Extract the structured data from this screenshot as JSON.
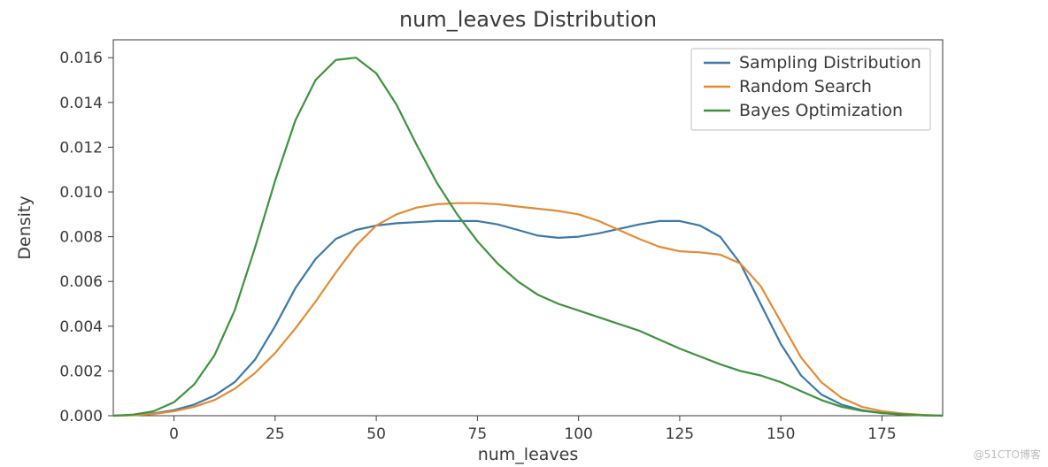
{
  "chart_data": {
    "type": "line",
    "title": "num_leaves Distribution",
    "xlabel": "num_leaves",
    "ylabel": "Density",
    "xlim": [
      -15,
      190
    ],
    "ylim": [
      0,
      0.0168
    ],
    "xticks": [
      0,
      25,
      50,
      75,
      100,
      125,
      150,
      175
    ],
    "yticks": [
      0.0,
      0.002,
      0.004,
      0.006,
      0.008,
      0.01,
      0.012,
      0.014,
      0.016
    ],
    "ytick_labels": [
      "0.000",
      "0.002",
      "0.004",
      "0.006",
      "0.008",
      "0.010",
      "0.012",
      "0.014",
      "0.016"
    ],
    "legend": {
      "position": "upper right",
      "entries": [
        "Sampling Distribution",
        "Random Search",
        "Bayes Optimization"
      ]
    },
    "colors": {
      "Sampling Distribution": "#3c79a6",
      "Random Search": "#e38b33",
      "Bayes Optimization": "#3d933d"
    },
    "x": [
      -15,
      -10,
      -5,
      0,
      5,
      10,
      15,
      20,
      25,
      30,
      35,
      40,
      45,
      50,
      55,
      60,
      65,
      70,
      75,
      80,
      85,
      90,
      95,
      100,
      105,
      110,
      115,
      120,
      125,
      130,
      135,
      140,
      145,
      150,
      155,
      160,
      165,
      170,
      175,
      180,
      185,
      190
    ],
    "series": [
      {
        "name": "Sampling Distribution",
        "values": [
          0.0,
          3e-05,
          0.0001,
          0.00025,
          0.0005,
          0.0009,
          0.0015,
          0.0025,
          0.004,
          0.0057,
          0.007,
          0.0079,
          0.0083,
          0.0085,
          0.0086,
          0.00865,
          0.0087,
          0.0087,
          0.0087,
          0.00855,
          0.0083,
          0.00805,
          0.00795,
          0.008,
          0.00815,
          0.00835,
          0.00855,
          0.0087,
          0.0087,
          0.0085,
          0.008,
          0.0068,
          0.005,
          0.0032,
          0.0018,
          0.00095,
          0.0005,
          0.00025,
          0.00012,
          5e-05,
          2e-05,
          0.0
        ]
      },
      {
        "name": "Random Search",
        "values": [
          0.0,
          2e-05,
          8e-05,
          0.0002,
          0.0004,
          0.0007,
          0.0012,
          0.0019,
          0.0028,
          0.0039,
          0.0051,
          0.0064,
          0.0076,
          0.0085,
          0.009,
          0.0093,
          0.00945,
          0.0095,
          0.0095,
          0.00945,
          0.00935,
          0.00925,
          0.00915,
          0.009,
          0.0087,
          0.0083,
          0.0079,
          0.00755,
          0.00735,
          0.0073,
          0.0072,
          0.0068,
          0.0058,
          0.0042,
          0.0026,
          0.0015,
          0.0008,
          0.0004,
          0.0002,
          0.0001,
          4e-05,
          0.0
        ]
      },
      {
        "name": "Bayes Optimization",
        "values": [
          0.0,
          5e-05,
          0.0002,
          0.0006,
          0.0014,
          0.0027,
          0.0047,
          0.0075,
          0.0105,
          0.0132,
          0.015,
          0.0159,
          0.016,
          0.0153,
          0.0139,
          0.0121,
          0.0104,
          0.009,
          0.0078,
          0.0068,
          0.006,
          0.0054,
          0.005,
          0.0047,
          0.0044,
          0.0041,
          0.0038,
          0.0034,
          0.003,
          0.00265,
          0.0023,
          0.002,
          0.0018,
          0.0015,
          0.0011,
          0.0007,
          0.0004,
          0.00022,
          0.00012,
          6e-05,
          2e-05,
          0.0
        ]
      }
    ]
  },
  "watermark": "@51CTO博客"
}
